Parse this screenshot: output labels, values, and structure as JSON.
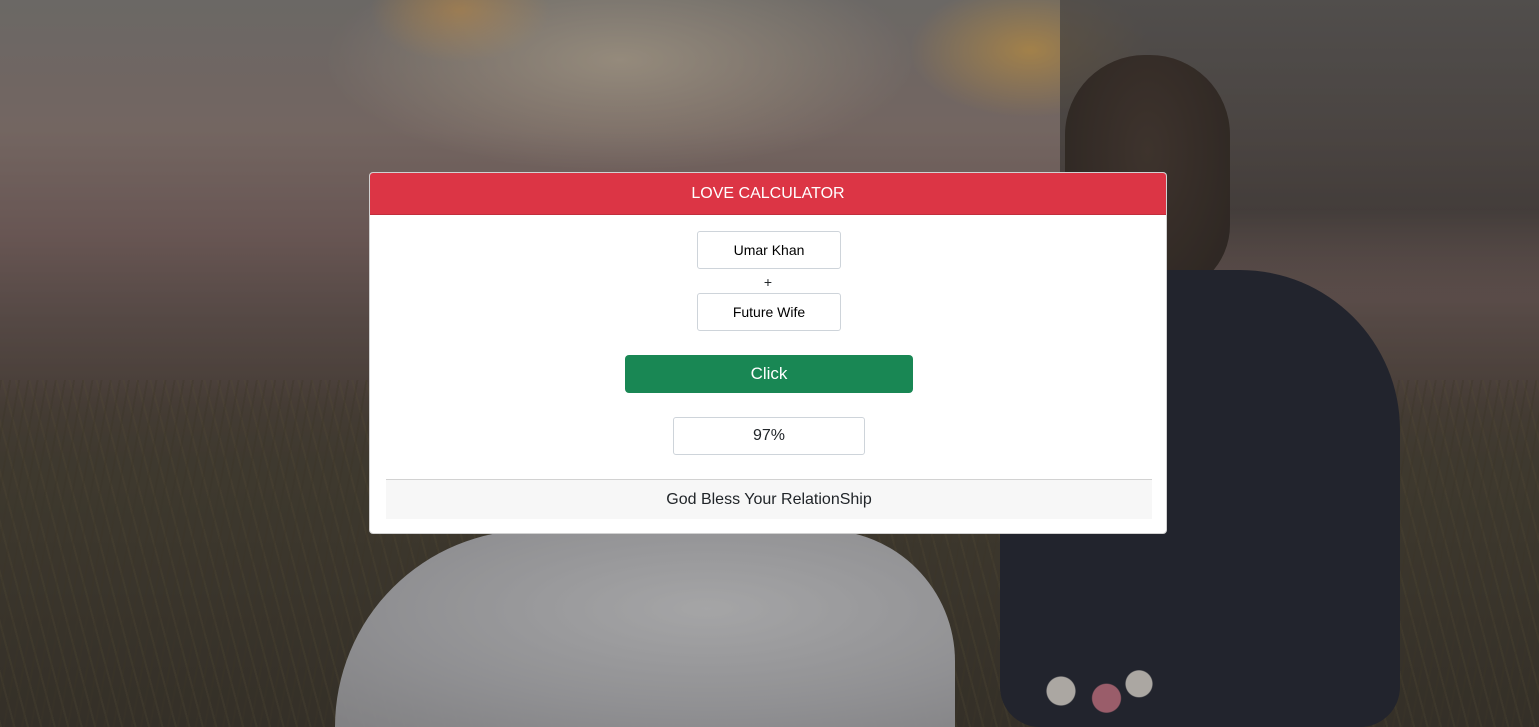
{
  "card": {
    "title": "LOVE CALCULATOR",
    "name1_value": "Umar Khan",
    "separator": "+",
    "name2_value": "Future Wife",
    "button_label": "Click",
    "result_value": "97%",
    "footer_message": "God Bless Your RelationShip"
  },
  "colors": {
    "header_bg": "#dc3545",
    "button_bg": "#198754",
    "footer_bg": "#f7f7f7"
  }
}
